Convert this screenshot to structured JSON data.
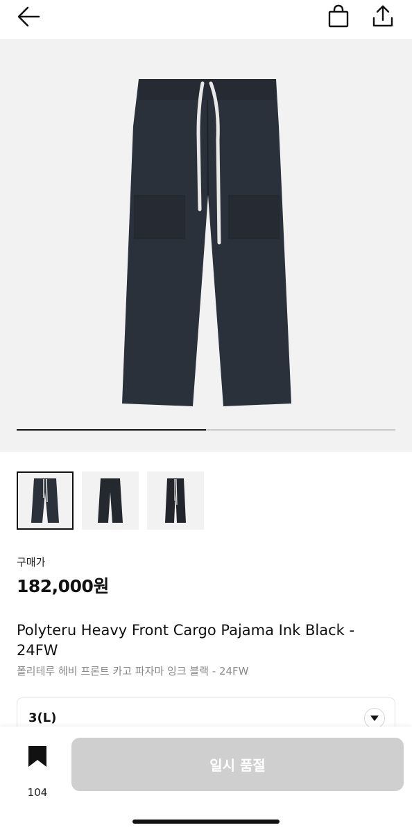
{
  "header": {
    "back_icon": "arrow-left-icon",
    "bag_icon": "shopping-bag-icon",
    "share_icon": "share-upload-icon"
  },
  "gallery": {
    "current_image": 1,
    "total_images": 2,
    "progress_fraction": 0.5,
    "thumbnails": [
      {
        "selected": true
      },
      {
        "selected": false
      },
      {
        "selected": false
      }
    ]
  },
  "product": {
    "price_label": "구매가",
    "price": "182,000원",
    "title_en": "Polyteru Heavy Front Cargo Pajama Ink Black - 24FW",
    "title_ko": "폴리테루 헤비 프론트 카고 파자마 잉크 블랙 - 24FW"
  },
  "option": {
    "selected_size": "3(L)",
    "dropdown_icon": "caret-down-icon"
  },
  "footer": {
    "wish_icon": "bookmark-icon",
    "wish_count": "104",
    "soldout_label": "일시 품절"
  },
  "colors": {
    "pants": "#2b313a",
    "drawstring": "#e8e8e8",
    "disabled_button": "#cfcfcf"
  }
}
